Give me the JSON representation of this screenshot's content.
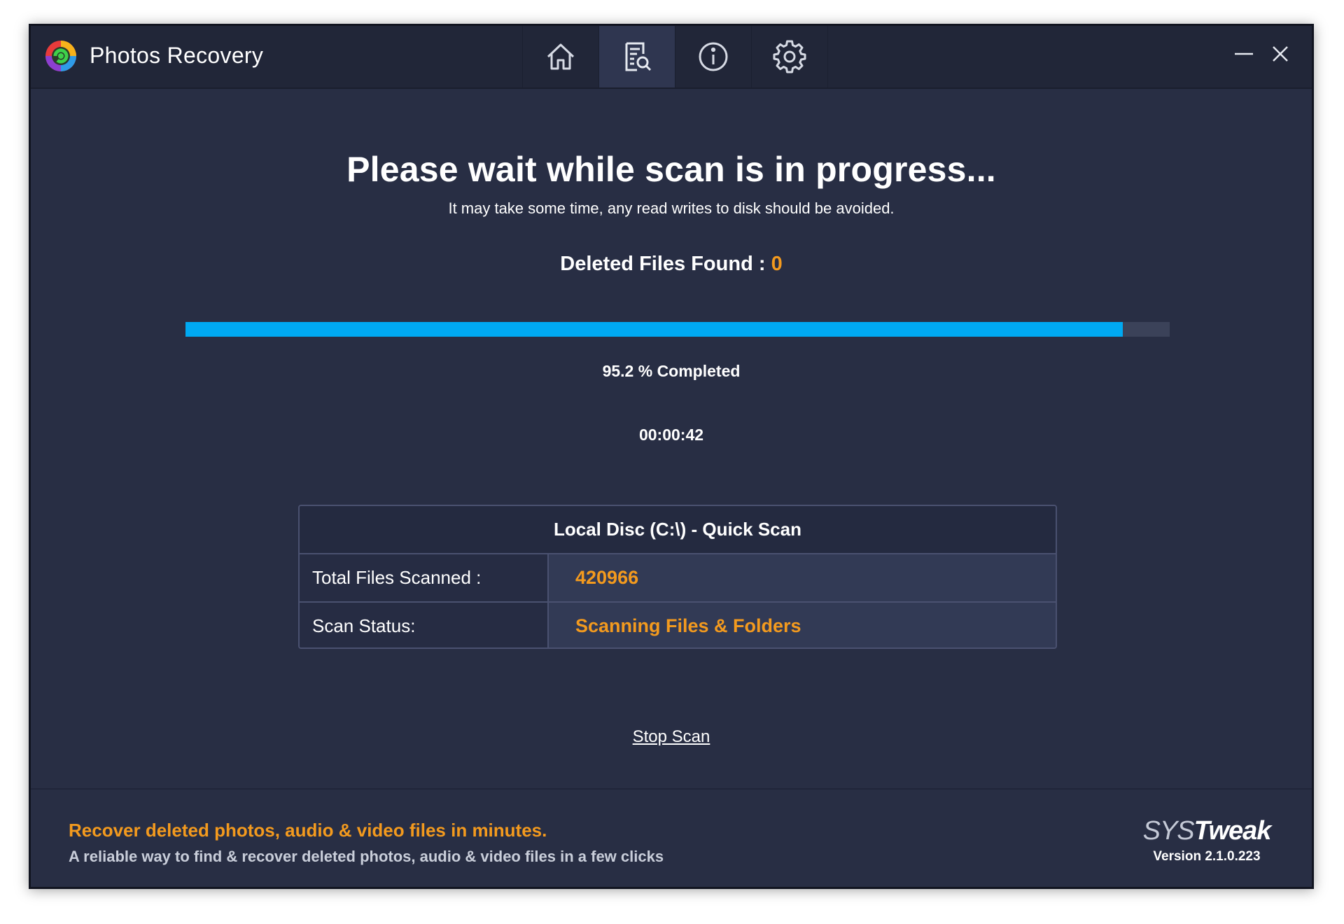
{
  "app": {
    "title": "Photos Recovery"
  },
  "nav": {
    "tabs": [
      {
        "name": "home",
        "icon": "home-icon",
        "active": false
      },
      {
        "name": "scan",
        "icon": "scan-report-icon",
        "active": true
      },
      {
        "name": "about",
        "icon": "info-icon",
        "active": false
      },
      {
        "name": "settings",
        "icon": "gear-icon",
        "active": false
      }
    ]
  },
  "window_controls": {
    "minimize_icon": "minimize-icon",
    "close_icon": "close-icon"
  },
  "scan": {
    "headline": "Please wait while scan is in progress...",
    "subline": "It may take some time, any read writes to disk should be avoided.",
    "found_label": "Deleted Files Found : ",
    "found_count": "0",
    "progress_percent": 95.2,
    "progress_text": "95.2 % Completed",
    "elapsed": "00:00:42"
  },
  "details": {
    "heading": "Local Disc (C:\\) - Quick Scan",
    "rows": [
      {
        "label": "Total Files Scanned :",
        "value": "420966"
      },
      {
        "label": "Scan Status:",
        "value": "Scanning Files & Folders"
      }
    ]
  },
  "actions": {
    "stop_label": "Stop Scan"
  },
  "footer": {
    "tagline": "Recover deleted photos, audio & video files in minutes.",
    "tagline_sub": "A reliable way to find & recover deleted photos, audio & video files in a few clicks",
    "brand_sys": "SYS",
    "brand_tweak": "Tweak",
    "version": "Version 2.1.0.223"
  },
  "colors": {
    "accent_orange": "#f39a1e",
    "progress_blue": "#00a9f2",
    "window_bg": "#282e44",
    "titlebar_bg": "#212638"
  }
}
